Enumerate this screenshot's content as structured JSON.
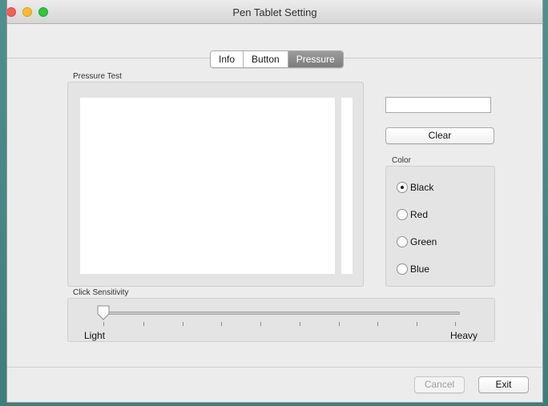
{
  "window": {
    "title": "Pen Tablet Setting"
  },
  "tabs": [
    {
      "label": "Info",
      "active": false
    },
    {
      "label": "Button",
      "active": false
    },
    {
      "label": "Pressure",
      "active": true
    }
  ],
  "pressure_test": {
    "label": "Pressure Test"
  },
  "pressure_value": {
    "value": "",
    "placeholder": ""
  },
  "clear_button": {
    "label": "Clear"
  },
  "color": {
    "label": "Color",
    "options": [
      {
        "label": "Black",
        "selected": true
      },
      {
        "label": "Red",
        "selected": false
      },
      {
        "label": "Green",
        "selected": false
      },
      {
        "label": "Blue",
        "selected": false
      }
    ]
  },
  "click_sensitivity": {
    "label": "Click Sensitivity",
    "min_label": "Light",
    "max_label": "Heavy",
    "level": 0
  },
  "footer": {
    "cancel_label": "Cancel",
    "exit_label": "Exit"
  }
}
